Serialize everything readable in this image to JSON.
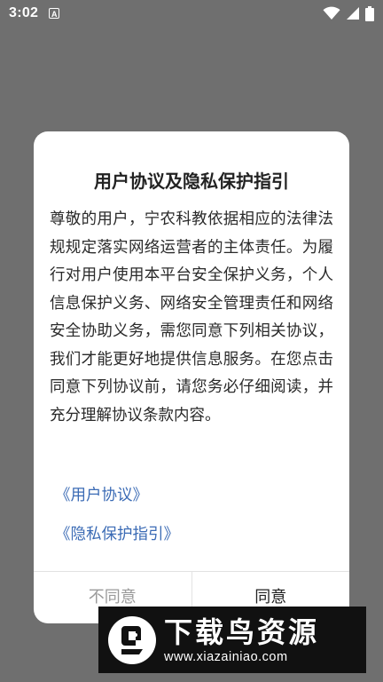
{
  "status_bar": {
    "time": "3:02",
    "notification_letter": "A"
  },
  "dialog": {
    "title": "用户协议及隐私保护指引",
    "body": "尊敬的用户，宁农科教依据相应的法律法规规定落实网络运营者的主体责任。为履行对用户使用本平台安全保护义务，个人信息保护义务、网络安全管理责任和网络安全协助义务，需您同意下列相关协议，我们才能更好地提供信息服务。在您点击同意下列协议前，请您务必仔细阅读，并充分理解协议条款内容。",
    "links": {
      "user_agreement": "《用户协议》",
      "privacy_guide": "《隐私保护指引》"
    },
    "buttons": {
      "disagree": "不同意",
      "agree": "同意"
    }
  },
  "watermark": {
    "title": "下载鸟资源",
    "url": "www.xiazainiao.com"
  }
}
